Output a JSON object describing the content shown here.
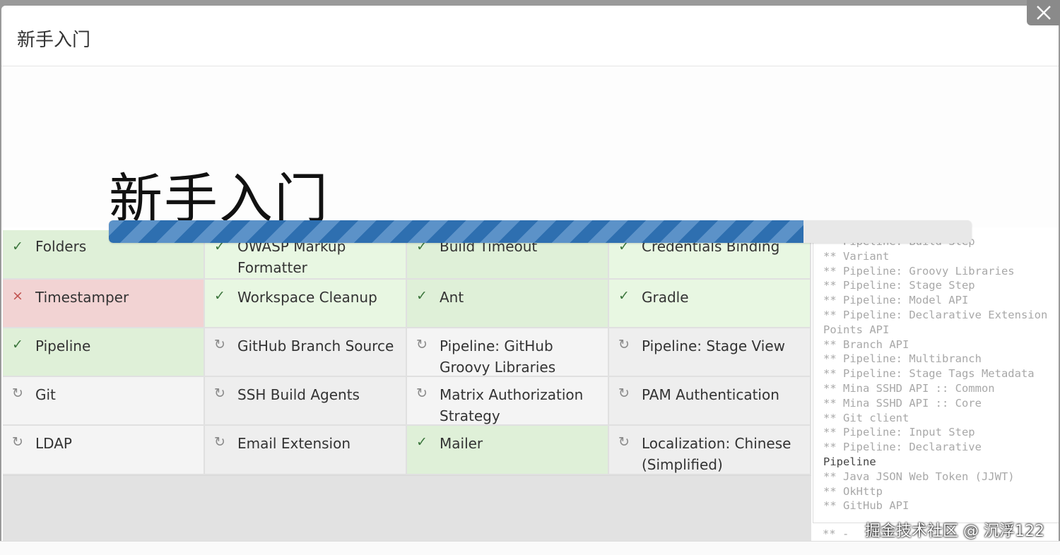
{
  "modal": {
    "title": "新手入门",
    "close_label": "×"
  },
  "hero": {
    "heading": "新手入门",
    "progress": 0.805
  },
  "plugins": [
    {
      "label": "Folders",
      "status": "ok",
      "icon": "check-icon",
      "glyph": "✓"
    },
    {
      "label": "OWASP Markup Formatter",
      "status": "ok",
      "icon": "check-icon",
      "glyph": "✓"
    },
    {
      "label": "Build Timeout",
      "status": "ok",
      "icon": "check-icon",
      "glyph": "✓"
    },
    {
      "label": "Credentials Binding",
      "status": "ok",
      "icon": "check-icon",
      "glyph": "✓"
    },
    {
      "label": "Timestamper",
      "status": "fail",
      "icon": "cross-icon",
      "glyph": "×"
    },
    {
      "label": "Workspace Cleanup",
      "status": "ok",
      "icon": "check-icon",
      "glyph": "✓"
    },
    {
      "label": "Ant",
      "status": "ok",
      "icon": "check-icon",
      "glyph": "✓"
    },
    {
      "label": "Gradle",
      "status": "ok",
      "icon": "check-icon",
      "glyph": "✓"
    },
    {
      "label": "Pipeline",
      "status": "ok",
      "icon": "check-icon",
      "glyph": "✓"
    },
    {
      "label": "GitHub Branch Source",
      "status": "pending",
      "icon": "refresh-icon",
      "glyph": "↻"
    },
    {
      "label": "Pipeline: GitHub Groovy Libraries",
      "status": "pending",
      "icon": "refresh-icon",
      "glyph": "↻"
    },
    {
      "label": "Pipeline: Stage View",
      "status": "pending",
      "icon": "refresh-icon",
      "glyph": "↻"
    },
    {
      "label": "Git",
      "status": "pending",
      "icon": "refresh-icon",
      "glyph": "↻"
    },
    {
      "label": "SSH Build Agents",
      "status": "pending",
      "icon": "refresh-icon",
      "glyph": "↻"
    },
    {
      "label": "Matrix Authorization Strategy",
      "status": "pending",
      "icon": "refresh-icon",
      "glyph": "↻"
    },
    {
      "label": "PAM Authentication",
      "status": "pending",
      "icon": "refresh-icon",
      "glyph": "↻"
    },
    {
      "label": "LDAP",
      "status": "pending",
      "icon": "refresh-icon",
      "glyph": "↻"
    },
    {
      "label": "Email Extension",
      "status": "pending",
      "icon": "refresh-icon",
      "glyph": "↻"
    },
    {
      "label": "Mailer",
      "status": "ok",
      "icon": "check-icon",
      "glyph": "✓"
    },
    {
      "label": "Localization: Chinese (Simplified)",
      "status": "pending",
      "icon": "refresh-icon",
      "glyph": "↻"
    }
  ],
  "log_lines": [
    {
      "text": "** Pipeline: Build Step",
      "dark": false
    },
    {
      "text": "** Variant",
      "dark": false
    },
    {
      "text": "** Pipeline: Groovy Libraries",
      "dark": false
    },
    {
      "text": "** Pipeline: Stage Step",
      "dark": false
    },
    {
      "text": "** Pipeline: Model API",
      "dark": false
    },
    {
      "text": "** Pipeline: Declarative Extension Points API",
      "dark": false
    },
    {
      "text": "** Branch API",
      "dark": false
    },
    {
      "text": "** Pipeline: Multibranch",
      "dark": false
    },
    {
      "text": "** Pipeline: Stage Tags Metadata",
      "dark": false
    },
    {
      "text": "** Mina SSHD API :: Common",
      "dark": false
    },
    {
      "text": "** Mina SSHD API :: Core",
      "dark": false
    },
    {
      "text": "** Git client",
      "dark": false
    },
    {
      "text": "** Pipeline: Input Step",
      "dark": false
    },
    {
      "text": "** Pipeline: Declarative",
      "dark": false
    },
    {
      "text": "Pipeline",
      "dark": true
    },
    {
      "text": "** Java JSON Web Token (JJWT)",
      "dark": false
    },
    {
      "text": "** OkHttp",
      "dark": false
    },
    {
      "text": "** GitHub API",
      "dark": false
    }
  ],
  "log_bottom": "** -",
  "watermark": "掘金技术社区 @ 沉浮122",
  "colors": {
    "success_bg": "#dff0d8",
    "fail_bg": "#f2d3d3",
    "pending_bg": "#f4f4f4",
    "progress_blue": "#2e6fb0"
  }
}
